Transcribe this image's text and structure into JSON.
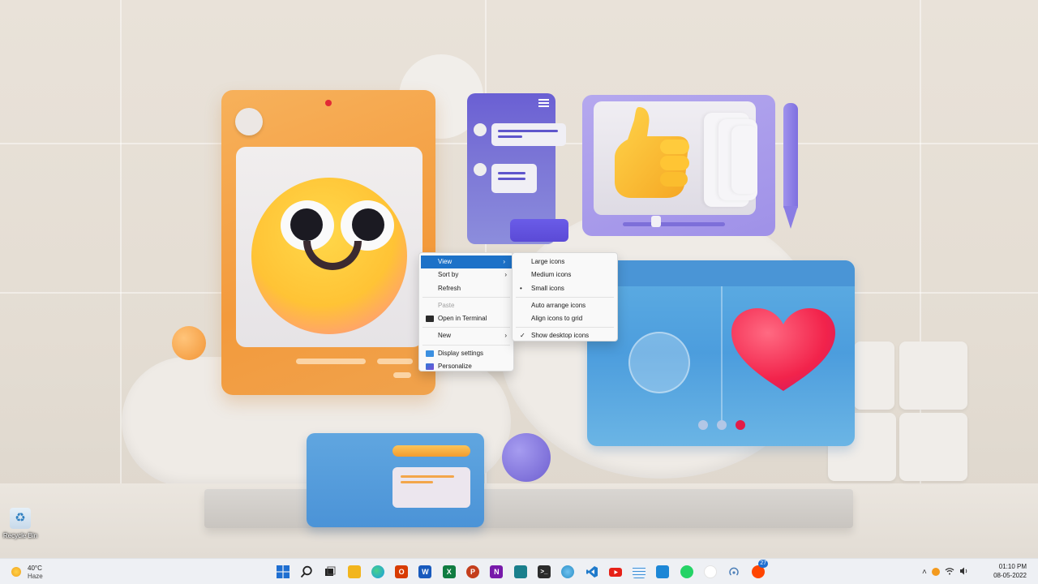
{
  "desktop": {
    "icons": [
      {
        "label": "Recycle Bin",
        "icon": "recycle-bin-icon"
      }
    ]
  },
  "context_menu": {
    "items": [
      {
        "label": "View",
        "submenu": true,
        "highlighted": true
      },
      {
        "label": "Sort by",
        "submenu": true
      },
      {
        "label": "Refresh"
      },
      {
        "label": "Paste",
        "disabled": true
      },
      {
        "label": "Open in Terminal",
        "icon": "terminal-icon"
      },
      {
        "label": "New",
        "submenu": true
      },
      {
        "label": "Display settings",
        "icon": "display-settings-icon"
      },
      {
        "label": "Personalize",
        "icon": "personalize-icon"
      }
    ],
    "submenu_view": {
      "items": [
        {
          "label": "Large icons"
        },
        {
          "label": "Medium icons"
        },
        {
          "label": "Small icons",
          "selected_radio": true
        },
        {
          "label": "Auto arrange icons"
        },
        {
          "label": "Align icons to grid"
        },
        {
          "label": "Show desktop icons",
          "checked": true
        }
      ]
    }
  },
  "taskbar": {
    "weather": {
      "temp": "40°C",
      "condition": "Haze",
      "icon": "haze-sun-icon"
    },
    "apps": [
      {
        "name": "start",
        "icon": "windows-start-icon",
        "color": "#1f6fd1"
      },
      {
        "name": "search",
        "icon": "search-icon",
        "color": "#333333"
      },
      {
        "name": "task-view",
        "icon": "task-view-icon",
        "color": "#333333"
      },
      {
        "name": "file-explorer",
        "icon": "folder-icon",
        "color": "#f2b51d"
      },
      {
        "name": "edge",
        "icon": "edge-browser-icon",
        "color": "#1b9de2"
      },
      {
        "name": "office",
        "icon": "office-icon",
        "color": "#d83b01"
      },
      {
        "name": "word",
        "icon": "word-icon",
        "color": "#185abd"
      },
      {
        "name": "excel",
        "icon": "excel-icon",
        "color": "#107c41"
      },
      {
        "name": "powerpoint",
        "icon": "powerpoint-icon",
        "color": "#c43e1c"
      },
      {
        "name": "onenote",
        "icon": "onenote-icon",
        "color": "#7719aa"
      },
      {
        "name": "store",
        "icon": "store-icon",
        "color": "#1a7f8c"
      },
      {
        "name": "terminal",
        "icon": "terminal-icon",
        "color": "#2b2b2b"
      },
      {
        "name": "globe-app",
        "icon": "globe-icon",
        "color": "#2a8fc7"
      },
      {
        "name": "vscode",
        "icon": "vscode-icon",
        "color": "#1f7acb"
      },
      {
        "name": "youtube",
        "icon": "youtube-icon",
        "color": "#e62117"
      },
      {
        "name": "notepad",
        "icon": "notepad-icon",
        "color": "#3c8fd6"
      },
      {
        "name": "remote-desktop",
        "icon": "monitor-icon",
        "color": "#1d87d6"
      },
      {
        "name": "whatsapp",
        "icon": "whatsapp-icon",
        "color": "#25d366"
      },
      {
        "name": "blank-app",
        "icon": "blank-circle-icon",
        "color": "#ffffff"
      },
      {
        "name": "wireless",
        "icon": "broadcast-icon",
        "color": "#4d7fb8"
      },
      {
        "name": "reddit",
        "icon": "reddit-icon",
        "color": "#ff4500",
        "badge": "27"
      }
    ],
    "tray": {
      "icons": [
        "chevron-up-icon",
        "orange-dot-icon",
        "wifi-icon",
        "speaker-icon"
      ]
    },
    "clock": {
      "time": "01:10 PM",
      "date": "08-05-2022"
    }
  }
}
